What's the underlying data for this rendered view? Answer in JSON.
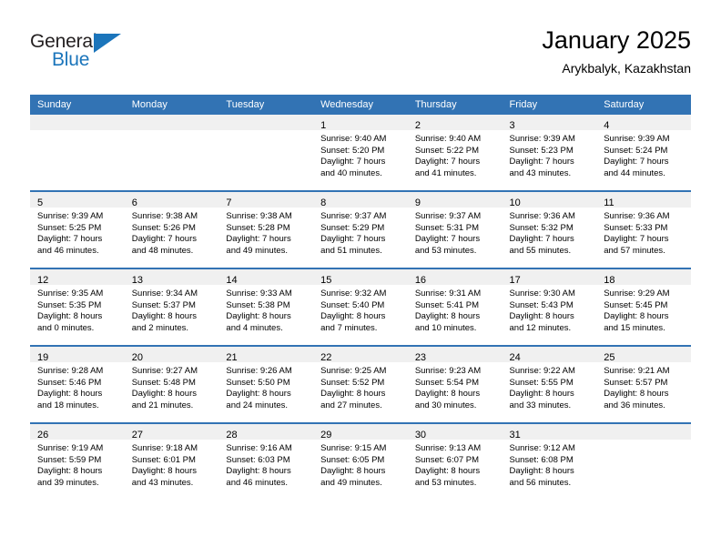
{
  "brand": {
    "name_top": "General",
    "name_bottom": "Blue",
    "accent_color": "#1b75bb",
    "logo_icon": "triangle-flag-icon"
  },
  "header": {
    "title": "January 2025",
    "subtitle": "Arykbalyk, Kazakhstan"
  },
  "theme": {
    "header_blue": "#3273b4",
    "band_gray": "#f0f0f0",
    "text_black": "#000000"
  },
  "weekdays": [
    "Sunday",
    "Monday",
    "Tuesday",
    "Wednesday",
    "Thursday",
    "Friday",
    "Saturday"
  ],
  "weeks": [
    [
      {
        "day": "",
        "sunrise": "",
        "sunset": "",
        "daylight1": "",
        "daylight2": ""
      },
      {
        "day": "",
        "sunrise": "",
        "sunset": "",
        "daylight1": "",
        "daylight2": ""
      },
      {
        "day": "",
        "sunrise": "",
        "sunset": "",
        "daylight1": "",
        "daylight2": ""
      },
      {
        "day": "1",
        "sunrise": "Sunrise: 9:40 AM",
        "sunset": "Sunset: 5:20 PM",
        "daylight1": "Daylight: 7 hours",
        "daylight2": "and 40 minutes."
      },
      {
        "day": "2",
        "sunrise": "Sunrise: 9:40 AM",
        "sunset": "Sunset: 5:22 PM",
        "daylight1": "Daylight: 7 hours",
        "daylight2": "and 41 minutes."
      },
      {
        "day": "3",
        "sunrise": "Sunrise: 9:39 AM",
        "sunset": "Sunset: 5:23 PM",
        "daylight1": "Daylight: 7 hours",
        "daylight2": "and 43 minutes."
      },
      {
        "day": "4",
        "sunrise": "Sunrise: 9:39 AM",
        "sunset": "Sunset: 5:24 PM",
        "daylight1": "Daylight: 7 hours",
        "daylight2": "and 44 minutes."
      }
    ],
    [
      {
        "day": "5",
        "sunrise": "Sunrise: 9:39 AM",
        "sunset": "Sunset: 5:25 PM",
        "daylight1": "Daylight: 7 hours",
        "daylight2": "and 46 minutes."
      },
      {
        "day": "6",
        "sunrise": "Sunrise: 9:38 AM",
        "sunset": "Sunset: 5:26 PM",
        "daylight1": "Daylight: 7 hours",
        "daylight2": "and 48 minutes."
      },
      {
        "day": "7",
        "sunrise": "Sunrise: 9:38 AM",
        "sunset": "Sunset: 5:28 PM",
        "daylight1": "Daylight: 7 hours",
        "daylight2": "and 49 minutes."
      },
      {
        "day": "8",
        "sunrise": "Sunrise: 9:37 AM",
        "sunset": "Sunset: 5:29 PM",
        "daylight1": "Daylight: 7 hours",
        "daylight2": "and 51 minutes."
      },
      {
        "day": "9",
        "sunrise": "Sunrise: 9:37 AM",
        "sunset": "Sunset: 5:31 PM",
        "daylight1": "Daylight: 7 hours",
        "daylight2": "and 53 minutes."
      },
      {
        "day": "10",
        "sunrise": "Sunrise: 9:36 AM",
        "sunset": "Sunset: 5:32 PM",
        "daylight1": "Daylight: 7 hours",
        "daylight2": "and 55 minutes."
      },
      {
        "day": "11",
        "sunrise": "Sunrise: 9:36 AM",
        "sunset": "Sunset: 5:33 PM",
        "daylight1": "Daylight: 7 hours",
        "daylight2": "and 57 minutes."
      }
    ],
    [
      {
        "day": "12",
        "sunrise": "Sunrise: 9:35 AM",
        "sunset": "Sunset: 5:35 PM",
        "daylight1": "Daylight: 8 hours",
        "daylight2": "and 0 minutes."
      },
      {
        "day": "13",
        "sunrise": "Sunrise: 9:34 AM",
        "sunset": "Sunset: 5:37 PM",
        "daylight1": "Daylight: 8 hours",
        "daylight2": "and 2 minutes."
      },
      {
        "day": "14",
        "sunrise": "Sunrise: 9:33 AM",
        "sunset": "Sunset: 5:38 PM",
        "daylight1": "Daylight: 8 hours",
        "daylight2": "and 4 minutes."
      },
      {
        "day": "15",
        "sunrise": "Sunrise: 9:32 AM",
        "sunset": "Sunset: 5:40 PM",
        "daylight1": "Daylight: 8 hours",
        "daylight2": "and 7 minutes."
      },
      {
        "day": "16",
        "sunrise": "Sunrise: 9:31 AM",
        "sunset": "Sunset: 5:41 PM",
        "daylight1": "Daylight: 8 hours",
        "daylight2": "and 10 minutes."
      },
      {
        "day": "17",
        "sunrise": "Sunrise: 9:30 AM",
        "sunset": "Sunset: 5:43 PM",
        "daylight1": "Daylight: 8 hours",
        "daylight2": "and 12 minutes."
      },
      {
        "day": "18",
        "sunrise": "Sunrise: 9:29 AM",
        "sunset": "Sunset: 5:45 PM",
        "daylight1": "Daylight: 8 hours",
        "daylight2": "and 15 minutes."
      }
    ],
    [
      {
        "day": "19",
        "sunrise": "Sunrise: 9:28 AM",
        "sunset": "Sunset: 5:46 PM",
        "daylight1": "Daylight: 8 hours",
        "daylight2": "and 18 minutes."
      },
      {
        "day": "20",
        "sunrise": "Sunrise: 9:27 AM",
        "sunset": "Sunset: 5:48 PM",
        "daylight1": "Daylight: 8 hours",
        "daylight2": "and 21 minutes."
      },
      {
        "day": "21",
        "sunrise": "Sunrise: 9:26 AM",
        "sunset": "Sunset: 5:50 PM",
        "daylight1": "Daylight: 8 hours",
        "daylight2": "and 24 minutes."
      },
      {
        "day": "22",
        "sunrise": "Sunrise: 9:25 AM",
        "sunset": "Sunset: 5:52 PM",
        "daylight1": "Daylight: 8 hours",
        "daylight2": "and 27 minutes."
      },
      {
        "day": "23",
        "sunrise": "Sunrise: 9:23 AM",
        "sunset": "Sunset: 5:54 PM",
        "daylight1": "Daylight: 8 hours",
        "daylight2": "and 30 minutes."
      },
      {
        "day": "24",
        "sunrise": "Sunrise: 9:22 AM",
        "sunset": "Sunset: 5:55 PM",
        "daylight1": "Daylight: 8 hours",
        "daylight2": "and 33 minutes."
      },
      {
        "day": "25",
        "sunrise": "Sunrise: 9:21 AM",
        "sunset": "Sunset: 5:57 PM",
        "daylight1": "Daylight: 8 hours",
        "daylight2": "and 36 minutes."
      }
    ],
    [
      {
        "day": "26",
        "sunrise": "Sunrise: 9:19 AM",
        "sunset": "Sunset: 5:59 PM",
        "daylight1": "Daylight: 8 hours",
        "daylight2": "and 39 minutes."
      },
      {
        "day": "27",
        "sunrise": "Sunrise: 9:18 AM",
        "sunset": "Sunset: 6:01 PM",
        "daylight1": "Daylight: 8 hours",
        "daylight2": "and 43 minutes."
      },
      {
        "day": "28",
        "sunrise": "Sunrise: 9:16 AM",
        "sunset": "Sunset: 6:03 PM",
        "daylight1": "Daylight: 8 hours",
        "daylight2": "and 46 minutes."
      },
      {
        "day": "29",
        "sunrise": "Sunrise: 9:15 AM",
        "sunset": "Sunset: 6:05 PM",
        "daylight1": "Daylight: 8 hours",
        "daylight2": "and 49 minutes."
      },
      {
        "day": "30",
        "sunrise": "Sunrise: 9:13 AM",
        "sunset": "Sunset: 6:07 PM",
        "daylight1": "Daylight: 8 hours",
        "daylight2": "and 53 minutes."
      },
      {
        "day": "31",
        "sunrise": "Sunrise: 9:12 AM",
        "sunset": "Sunset: 6:08 PM",
        "daylight1": "Daylight: 8 hours",
        "daylight2": "and 56 minutes."
      },
      {
        "day": "",
        "sunrise": "",
        "sunset": "",
        "daylight1": "",
        "daylight2": ""
      }
    ]
  ]
}
